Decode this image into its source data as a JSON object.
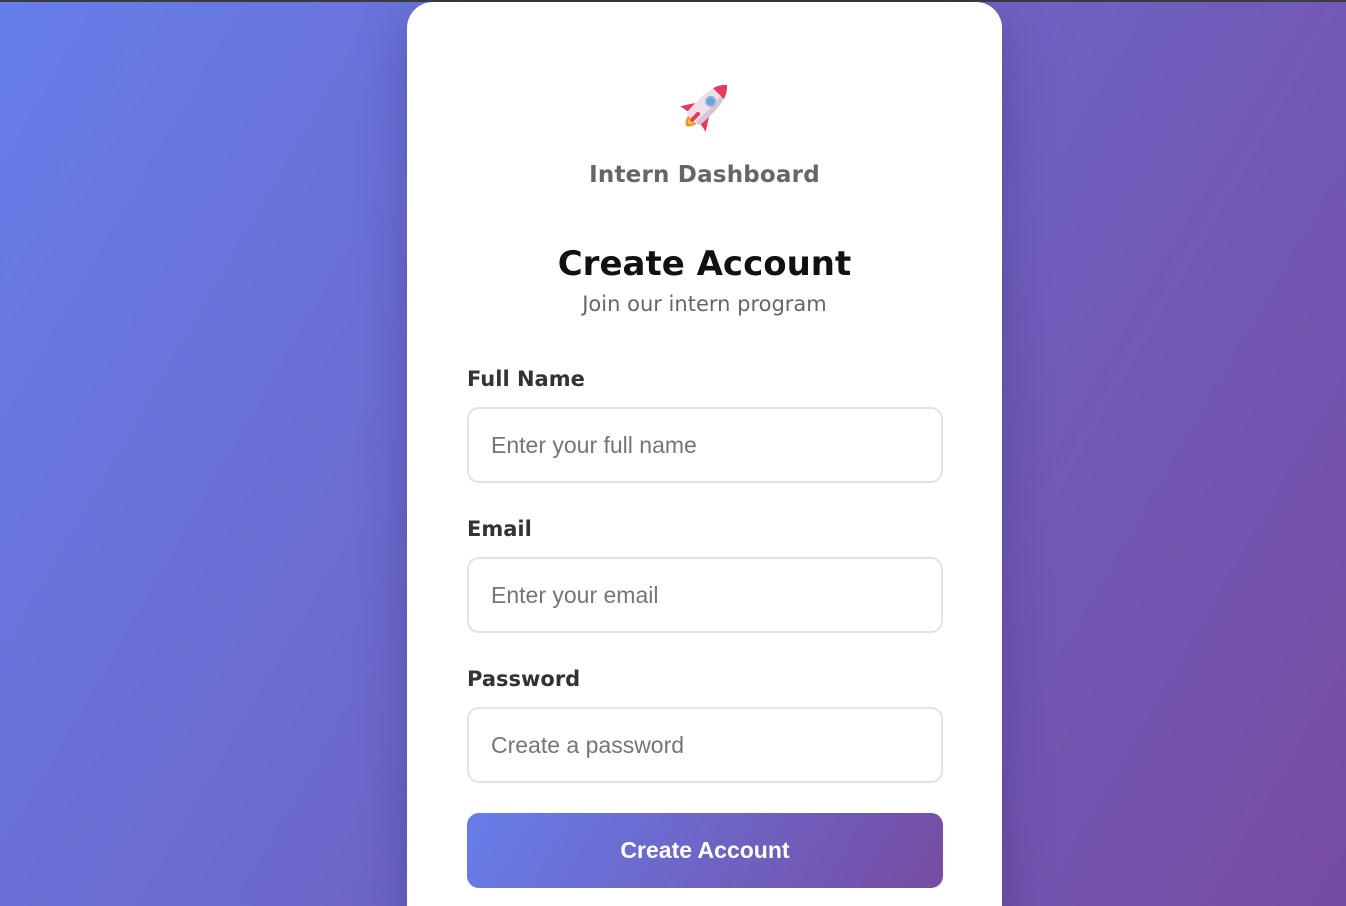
{
  "app": {
    "brand_name": "Intern Dashboard",
    "logo_icon": "rocket-icon"
  },
  "form": {
    "title": "Create Account",
    "subtitle": "Join our intern program",
    "fields": [
      {
        "label": "Full Name",
        "value": "",
        "placeholder": "Enter your full name"
      },
      {
        "label": "Email",
        "value": "",
        "placeholder": "Enter your email"
      },
      {
        "label": "Password",
        "value": "",
        "placeholder": "Create a password"
      }
    ],
    "submit_label": "Create Account"
  },
  "colors": {
    "gradient_start": "#667eea",
    "gradient_end": "#764ba2",
    "card_background": "#ffffff",
    "heading": "#111111",
    "muted_text": "#666666",
    "label_text": "#333333",
    "input_border": "#e3e3e3"
  }
}
